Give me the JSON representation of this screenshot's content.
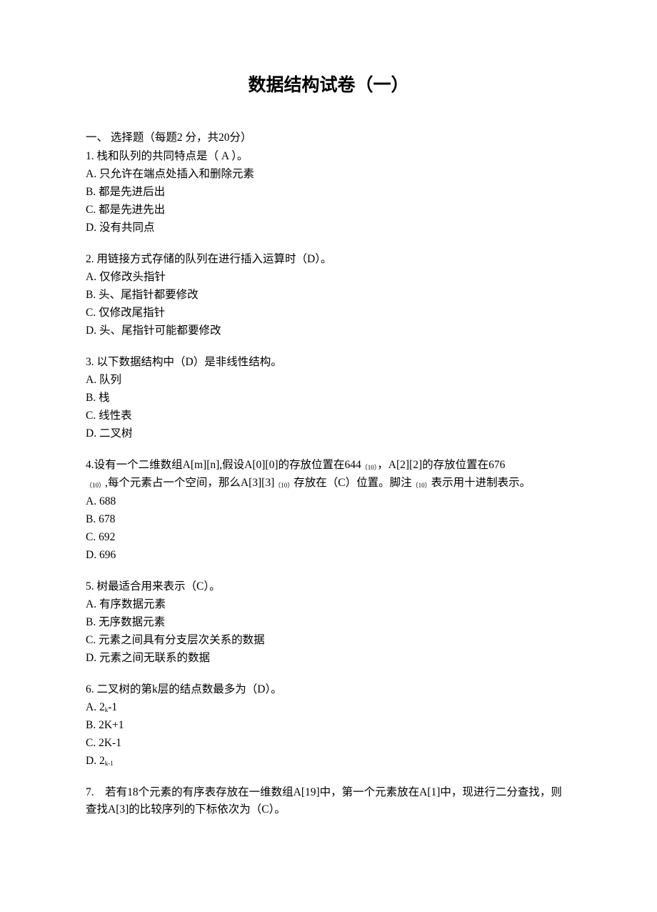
{
  "title": "数据结构试卷（一）",
  "section": "一、 选择题（每题2 分，共20分）",
  "questions": [
    {
      "text": "1. 栈和队列的共同特点是（ A ）。",
      "options": [
        "A. 只允许在端点处插入和删除元素",
        "B. 都是先进后出",
        "C. 都是先进先出",
        "D. 没有共同点"
      ]
    },
    {
      "text": "2. 用链接方式存储的队列在进行插入运算时（D）。",
      "options": [
        "A. 仅修改头指针",
        "B. 头、尾指针都要修改",
        "C. 仅修改尾指针",
        "D. 头、尾指针可能都要修改"
      ]
    },
    {
      "text": "3. 以下数据结构中（D）是非线性结构。",
      "options": [
        "A. 队列",
        "B. 栈",
        "C. 线性表",
        "D. 二叉树"
      ]
    },
    {
      "text_parts": {
        "p1": "4.设有一个二维数组A[m][n],假设A[0][0]的存放位置在644",
        "s1": "（10）",
        "p2": "，A[2][2]的存放位置在676",
        "s2": "（10）",
        "p3": ",每个元素占一个空间，那么A[3][3]",
        "s3": "（10）",
        "p4": "存放在（C）位置。脚注",
        "s4": "（10）",
        "p5": "表示用十进制表示。"
      },
      "options": [
        "A. 688",
        "B. 678",
        "C. 692",
        "D. 696"
      ]
    },
    {
      "text": "5. 树最适合用来表示（C）。",
      "options": [
        "A. 有序数据元素",
        "B. 无序数据元素",
        "C. 元素之间具有分支层次关系的数据",
        "D. 元素之间无联系的数据"
      ]
    },
    {
      "text": "6. 二叉树的第k层的结点数最多为（D）。",
      "options_parts": [
        {
          "pre": "A. 2",
          "sub": "k",
          "post": "-1"
        },
        {
          "plain": "B. 2K+1"
        },
        {
          "plain": "C. 2K-1"
        },
        {
          "pre": "D. 2",
          "sub": "k-1",
          "post": ""
        }
      ]
    },
    {
      "text": "7.　若有18个元素的有序表存放在一维数组A[19]中，第一个元素放在A[1]中，现进行二分查找，则查找A[3]的比较序列的下标依次为（C）。"
    }
  ]
}
